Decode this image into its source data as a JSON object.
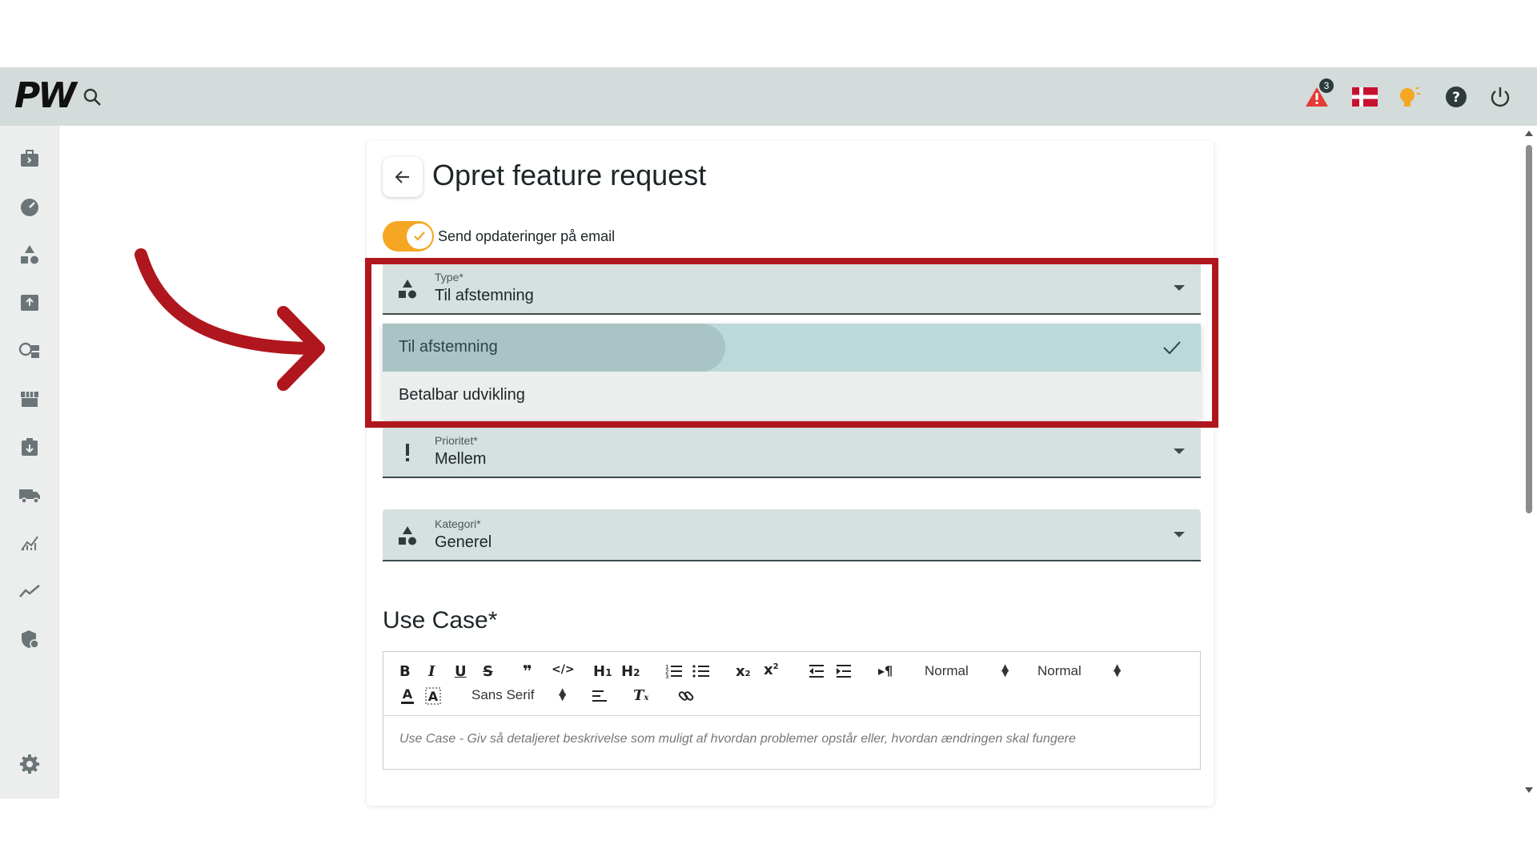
{
  "topbar": {
    "logo": "PW",
    "notifications_count": "3"
  },
  "sidebar": {
    "items": [
      "cases-icon",
      "dashboard-icon",
      "shapes-icon",
      "upload-icon",
      "chat-icon",
      "store-icon",
      "download-icon",
      "truck-icon",
      "analytics-icon",
      "trend-icon",
      "security-icon"
    ],
    "settings": "settings-icon"
  },
  "form": {
    "title": "Opret feature request",
    "email_toggle_label": "Send opdateringer på email",
    "type": {
      "label": "Type*",
      "value": "Til afstemning"
    },
    "type_options": [
      "Til afstemning",
      "Betalbar udvikling"
    ],
    "priority": {
      "label": "Prioritet*",
      "value": "Mellem"
    },
    "category": {
      "label": "Kategori*",
      "value": "Generel"
    },
    "use_case_title": "Use Case*",
    "editor": {
      "header_select_1": "Normal",
      "header_select_2": "Normal",
      "font_select": "Sans Serif",
      "placeholder": "Use Case - Giv så detaljeret beskrivelse som muligt af hvordan problemer opstår eller, hvordan ændringen skal fungere"
    }
  },
  "colors": {
    "accent_orange": "#f5a623",
    "highlight_red": "#b0161d",
    "field_bg": "#d6e0df",
    "topbar_bg": "#d3dcda"
  }
}
